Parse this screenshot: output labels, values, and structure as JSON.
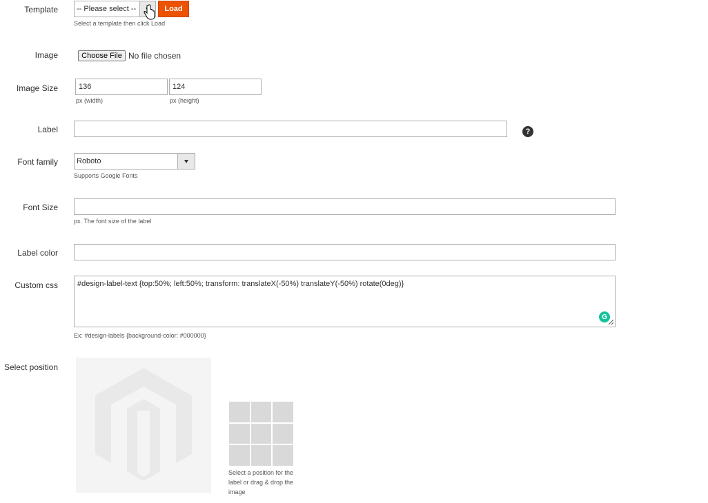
{
  "template": {
    "label": "Template",
    "select_value": "-- Please select --",
    "load_button": "Load",
    "note": "Select a template then click Load"
  },
  "image": {
    "label": "Image",
    "choose_button": "Choose File",
    "status": "No file chosen"
  },
  "image_size": {
    "label": "Image Size",
    "width_value": "136",
    "width_note": "px (width)",
    "height_value": "124",
    "height_note": "px (height)"
  },
  "label_field": {
    "label": "Label",
    "value": "",
    "help": "?"
  },
  "font_family": {
    "label": "Font family",
    "value": "Roboto",
    "note": "Supports Google Fonts"
  },
  "font_size": {
    "label": "Font Size",
    "value": "",
    "note": "px. The font size of the label"
  },
  "label_color": {
    "label": "Label color",
    "value": ""
  },
  "custom_css": {
    "label": "Custom css",
    "value": "#design-label-text {top:50%; left:50%; transform: translateX(-50%) translateY(-50%) rotate(0deg)}",
    "note": "Ex: #design-labels {background-color: #000000}"
  },
  "select_position": {
    "label": "Select position",
    "note": "Select a position for the label or drag & drop the image"
  },
  "colors": {
    "accent": "#eb5202",
    "grid_cell": "#d9d9d9",
    "preview_bg": "#f4f4f4"
  }
}
